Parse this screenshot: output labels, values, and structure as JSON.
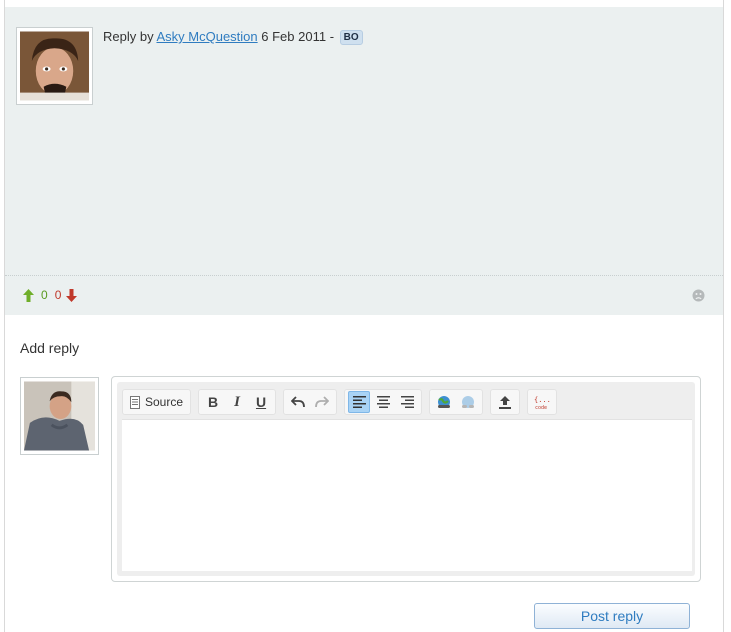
{
  "reply": {
    "prefix": "Reply by",
    "author": "Asky McQuestion",
    "date": "6 Feb 2011",
    "separator": "-",
    "badge": "BO",
    "votes_up": "0",
    "votes_down": "0"
  },
  "add_reply": {
    "title": "Add reply",
    "post_label": "Post reply"
  },
  "editor": {
    "source_label": "Source",
    "buttons": [
      "bold",
      "italic",
      "underline",
      "undo",
      "redo",
      "align-left",
      "align-center",
      "align-right",
      "link",
      "unlink",
      "upload",
      "code"
    ],
    "active_button": "align-left",
    "disabled_buttons": [
      "redo",
      "unlink"
    ]
  },
  "colors": {
    "card_bg": "#ebf0f0",
    "link": "#2f7cc0",
    "vote_up": "#5a9a1f",
    "vote_down": "#c0392b",
    "badge_bg": "#cfe0ef"
  }
}
